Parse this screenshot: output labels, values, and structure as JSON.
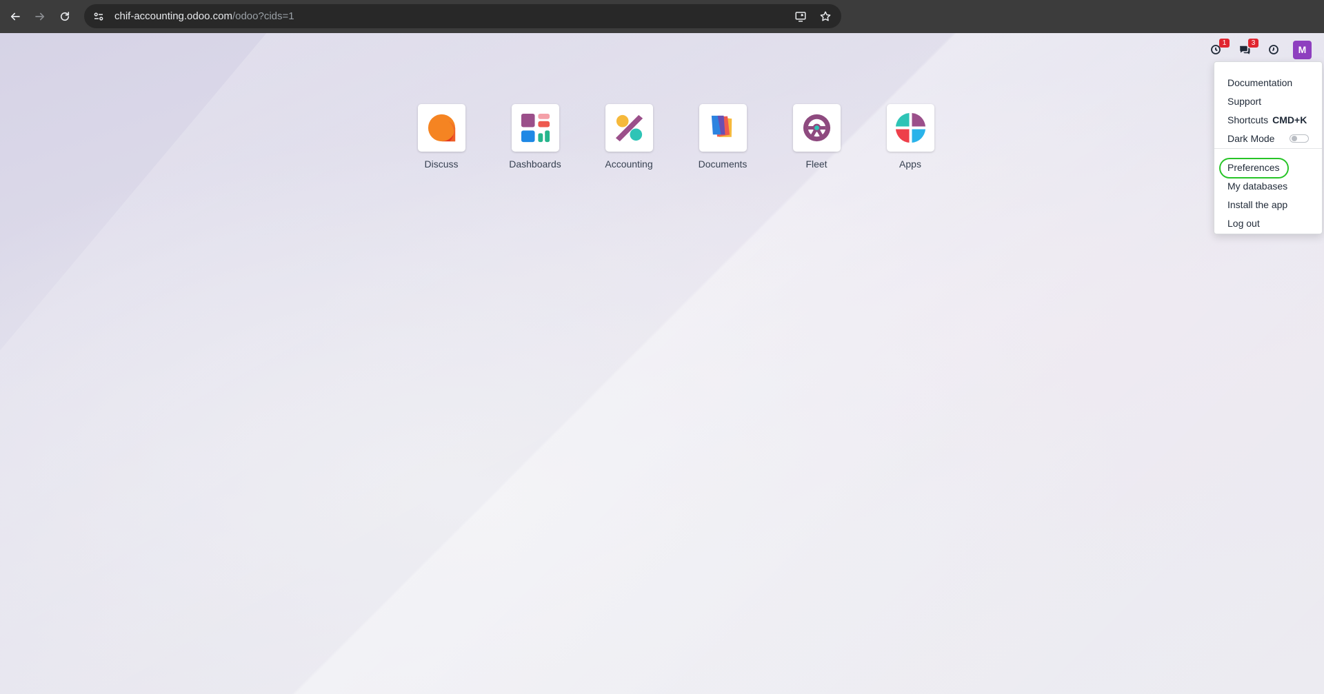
{
  "browser": {
    "url_host": "chif-accounting.odoo.com",
    "url_path": "/odoo?cids=1"
  },
  "systray": {
    "activity_badge": "1",
    "messages_badge": "3",
    "avatar_letter": "M"
  },
  "apps": [
    {
      "label": "Discuss",
      "icon": "discuss-icon"
    },
    {
      "label": "Dashboards",
      "icon": "dashboards-icon"
    },
    {
      "label": "Accounting",
      "icon": "accounting-icon"
    },
    {
      "label": "Documents",
      "icon": "documents-icon"
    },
    {
      "label": "Fleet",
      "icon": "fleet-icon"
    },
    {
      "label": "Apps",
      "icon": "apps-icon"
    }
  ],
  "user_menu": {
    "documentation": "Documentation",
    "support": "Support",
    "shortcuts": "Shortcuts",
    "shortcuts_key": "CMD+K",
    "dark_mode": "Dark Mode",
    "dark_mode_on": false,
    "preferences": "Preferences",
    "my_databases": "My databases",
    "install_app": "Install the app",
    "log_out": "Log out",
    "highlight_color": "#27c427"
  },
  "colors": {
    "chrome_bg": "#3c3c3c",
    "avatar_bg": "#8e3fbf",
    "badge_bg": "#e0252f"
  }
}
